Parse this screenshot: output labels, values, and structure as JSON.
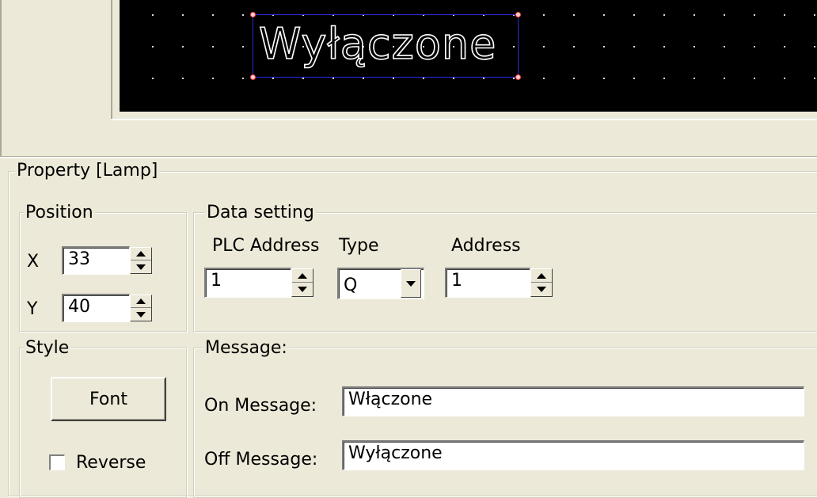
{
  "preview": {
    "display_text": "Wyłączone"
  },
  "property_group": {
    "title": "Property  [Lamp]"
  },
  "position_group": {
    "title": "Position",
    "x_label": "X",
    "x_value": "33",
    "y_label": "Y",
    "y_value": "40"
  },
  "data_setting_group": {
    "title": "Data setting",
    "plc_address_label": "PLC Address",
    "type_label": "Type",
    "address_label": "Address",
    "plc_address_value": "1",
    "type_value": "Q",
    "address_value": "1"
  },
  "style_group": {
    "title": "Style",
    "font_button_label": "Font",
    "reverse_label": "Reverse",
    "reverse_checked": false
  },
  "message_group": {
    "title": "Message:",
    "on_message_label": "On Message:",
    "on_message_value": "Włączone",
    "off_message_label": "Off Message:",
    "off_message_value": "Wyłączone"
  },
  "icons": {
    "spin": "up-down-arrows-icon",
    "dropdown": "chevron-down-icon"
  },
  "colors": {
    "window_bg": "#ece9d8",
    "lcd_bg": "#000000",
    "selection_border": "#2b2bd6",
    "handle": "#ff4040"
  }
}
